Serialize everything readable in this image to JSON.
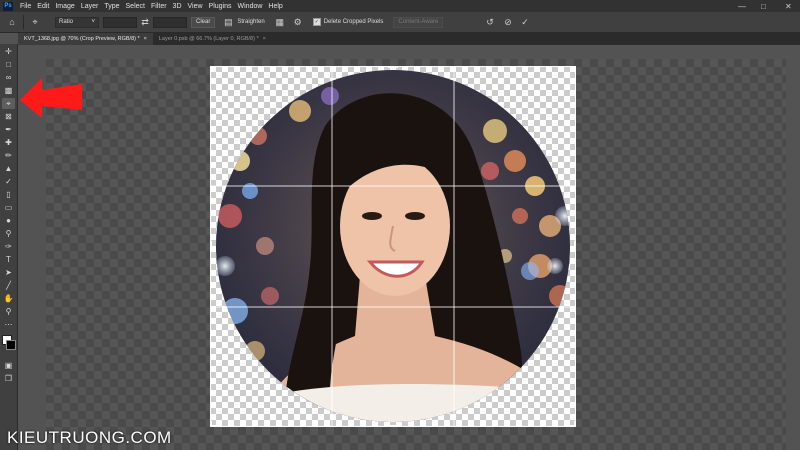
{
  "menu": [
    "File",
    "Edit",
    "Image",
    "Layer",
    "Type",
    "Select",
    "Filter",
    "3D",
    "View",
    "Plugins",
    "Window",
    "Help"
  ],
  "options": {
    "ratio_label": "Ratio",
    "clear_label": "Clear",
    "straighten_label": "Straighten",
    "delete_cropped_label": "Delete Cropped Pixels",
    "content_aware_label": "Content-Aware"
  },
  "tabs": [
    {
      "label": "KVT_1368.jpg @ 70% (Crop Preview, RGB/8) *",
      "active": true
    },
    {
      "label": "Layer 0.psb @ 66.7% (Layer 0, RGB/8) *",
      "active": false
    }
  ],
  "watermark": "KIEUTRUONG.COM",
  "colors": {
    "accent_arrow": "#ff1a1a",
    "menubar": "#323232",
    "toolbar": "#404040"
  },
  "tools": [
    "move-icon",
    "marquee-icon",
    "lasso-icon",
    "object-select-icon",
    "crop-icon",
    "frame-icon",
    "eyedropper-icon",
    "healing-brush-icon",
    "brush-icon",
    "clone-stamp-icon",
    "history-brush-icon",
    "eraser-icon",
    "gradient-icon",
    "blur-icon",
    "dodge-icon",
    "pen-icon",
    "type-icon",
    "path-select-icon",
    "line-icon",
    "hand-icon",
    "zoom-icon",
    "more-icon"
  ]
}
